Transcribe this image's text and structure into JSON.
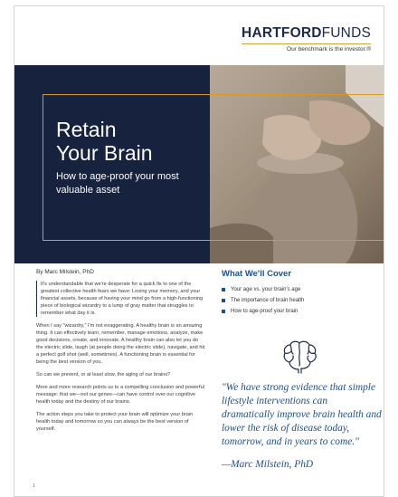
{
  "brand": {
    "name_bold": "HARTFORD",
    "name_light": "FUNDS",
    "tagline": "Our benchmark is the investor.®"
  },
  "hero": {
    "title_line1": "Retain",
    "title_line2": "Your Brain",
    "subtitle": "How to age-proof your most valuable asset"
  },
  "byline": "By Marc Milstein, PhD",
  "body": [
    "It's understandable that we're desperate for a quick fix to one of the greatest collective health fears we have: Losing your memory, and your financial assets, because of having your mind go from a high-functioning piece of biological wizardry to a lump of gray matter that struggles to remember what day it is.",
    "When I say \"wizardry,\" I'm not exaggerating. A healthy brain is an amazing thing. It can effectively learn, remember, manage emotions, analyze, make good decisions, create, and innovate. A healthy brain can also let you do the electric slide, laugh (at people doing the electric slide), navigate, and hit a perfect golf shot (well, sometimes). A functioning brain is essential for being the best version of you.",
    "So can we prevent, or at least slow, the aging of our brains?",
    "More and more research points us to a compelling conclusion and powerful message: that we—not our genes—can have control over our cognitive health today and the destiny of our brains.",
    "The action steps you take to protect your brain will optimize your brain health today and tomorrow so you can always be the best version of yourself."
  ],
  "cover": {
    "heading": "What We'll Cover",
    "items": [
      "Your age vs. your brain's age",
      "The importance of brain health",
      "How to age-proof your brain"
    ]
  },
  "quote": {
    "text": "\"We have strong evidence that simple lifestyle interventions can dramatically improve brain health and lower the risk of disease today, tomorrow, and in years to come.\"",
    "author": "—Marc Milstein, PhD"
  },
  "page_number": "1",
  "colors": {
    "navy": "#17223f",
    "gold": "#d29b31",
    "blue": "#1f4f8a"
  },
  "icons": [
    "brain-icon"
  ]
}
